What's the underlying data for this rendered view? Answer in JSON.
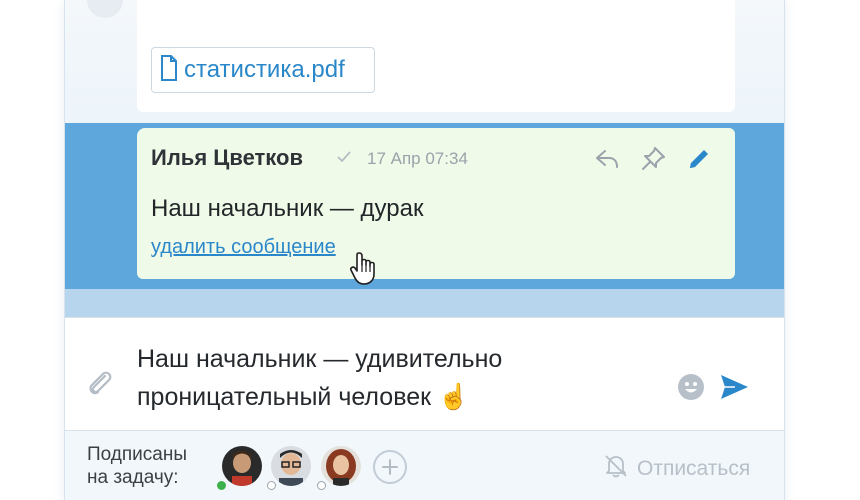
{
  "previous_message": {
    "attachment": {
      "icon": "document-icon",
      "file_name": "статистика.pdf"
    }
  },
  "message": {
    "author": "Илья Цветков",
    "timestamp": "17 Апр 07:34",
    "body": "Наш начальник — дурак",
    "delete_link": "удалить сообщение",
    "actions": [
      "reply-icon",
      "pin-icon",
      "edit-icon"
    ],
    "highlight_color": "#5ea7dc",
    "bubble_color": "#f0fae9"
  },
  "composer": {
    "text": "Наш начальник — удивительно проницательный человек ☝",
    "emoji_button": "smiley-icon",
    "send_button": "send-icon",
    "attach_button": "paperclip-icon"
  },
  "footer": {
    "subscribers_label": "Подписаны на задачу:",
    "subscribers": [
      {
        "avatar": "avatar-1",
        "status": "online",
        "status_color": "#3cb04a"
      },
      {
        "avatar": "avatar-2",
        "status": "offline"
      },
      {
        "avatar": "avatar-3",
        "status": "offline"
      }
    ],
    "add_button": "plus-icon",
    "unsubscribe_label": "Отписаться",
    "accent_color": "#2a87c9"
  }
}
